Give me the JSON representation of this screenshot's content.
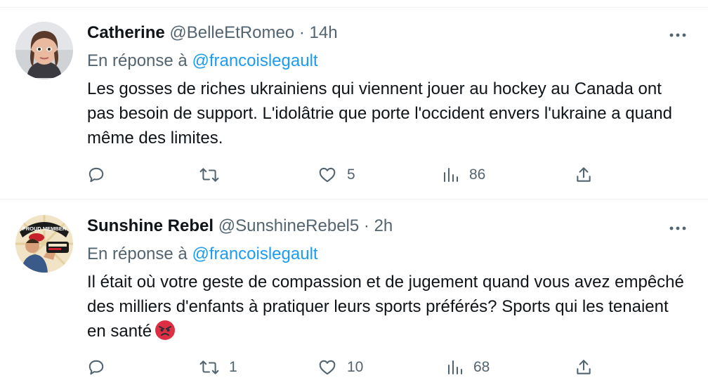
{
  "tweets": [
    {
      "display_name": "Catherine",
      "handle": "@BelleEtRomeo",
      "separator": "·",
      "time": "14h",
      "reply_prefix": "En réponse à",
      "reply_mention": "@francoislegault",
      "text": "Les gosses de riches ukrainiens qui viennent jouer au hockey au Canada ont pas besoin de support. L'idolâtrie que porte l'occident envers l'ukraine a quand même des limites.",
      "replies": "",
      "retweets": "",
      "likes": "5",
      "views": "86"
    },
    {
      "display_name": "Sunshine Rebel",
      "handle": "@SunshineRebel5",
      "separator": "·",
      "time": "2h",
      "reply_prefix": "En réponse à",
      "reply_mention": "@francoislegault",
      "text": "Il était où votre geste de compassion et de jugement quand vous avez empêché des milliers d'enfants à pratiquer leurs sports préférés? Sports qui les tenaient en santé",
      "avatar_badge_text": "PROUD MEMBER",
      "replies": "",
      "retweets": "1",
      "likes": "10",
      "views": "68"
    }
  ],
  "colors": {
    "text": "#0f1419",
    "secondary": "#536471",
    "link": "#1d9bf0",
    "divider": "#eff3f4"
  },
  "icons": {
    "more": "more-dots-icon",
    "reply": "reply-bubble-icon",
    "retweet": "retweet-arrows-icon",
    "like": "heart-icon",
    "views": "bar-chart-icon",
    "share": "share-arrow-icon",
    "emoji": "angry-face-emoji"
  }
}
